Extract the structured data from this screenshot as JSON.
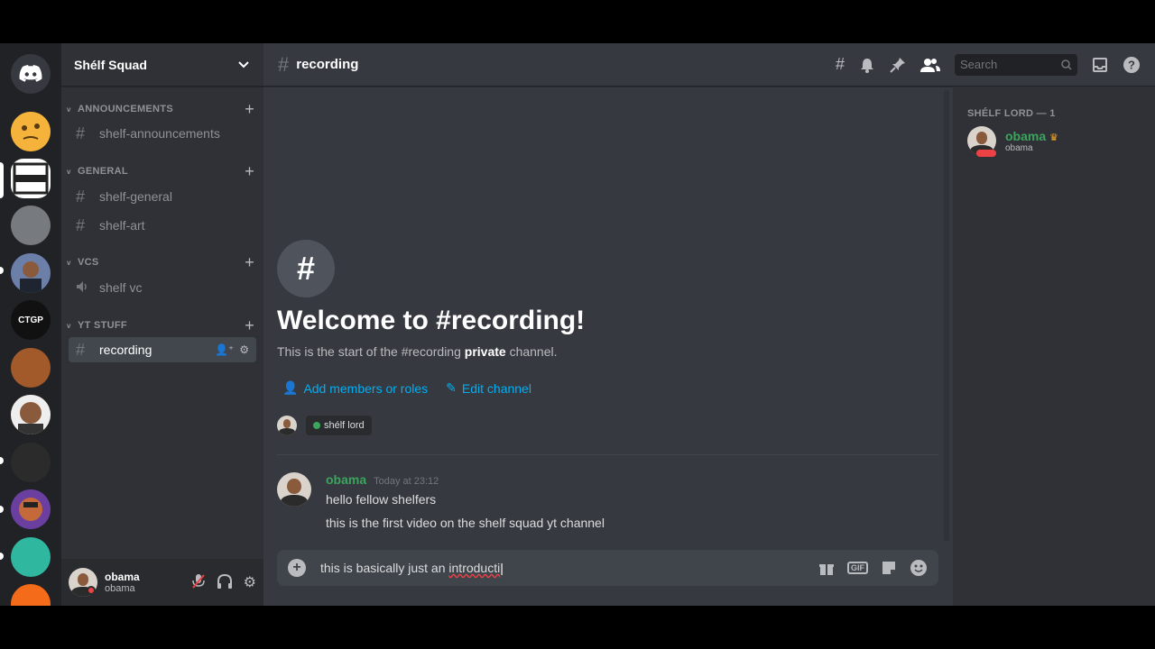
{
  "servers": [
    {
      "name": "home",
      "icon": "discord-icon",
      "color": "#36393f"
    },
    {
      "name": "server-emoji",
      "color": "#f5b33b"
    },
    {
      "name": "server-frame",
      "color": "#ffffff"
    },
    {
      "name": "server-gray",
      "color": "#777b80"
    },
    {
      "name": "server-obama",
      "color": "#3a4f7a"
    },
    {
      "name": "server-records",
      "color": "#111111"
    },
    {
      "name": "server-food",
      "color": "#a35a2a"
    },
    {
      "name": "server-rock",
      "color": "#b7775a"
    },
    {
      "name": "server-dark",
      "color": "#2b2b2b"
    },
    {
      "name": "server-purple",
      "color": "#6b3fa0"
    },
    {
      "name": "server-green",
      "color": "#2fb7a0"
    },
    {
      "name": "server-orange",
      "color": "#f46b1a"
    }
  ],
  "sidebar": {
    "guild_name": "Shélf Squad",
    "categories": [
      {
        "label": "ANNOUNCEMENTS",
        "channels": [
          "shelf-announcements"
        ]
      },
      {
        "label": "GENERAL",
        "channels": [
          "shelf-general",
          "shelf-art"
        ]
      },
      {
        "label": "VCS",
        "channels": [
          "shelf vc"
        ]
      },
      {
        "label": "YT STUFF",
        "channels": [
          "recording"
        ]
      }
    ]
  },
  "user_panel": {
    "name": "obama",
    "tag": "obama"
  },
  "topbar": {
    "channel": "recording",
    "search_placeholder": "Search"
  },
  "welcome": {
    "title": "Welcome to #recording!",
    "sub_pre": "This is the start of the #recording ",
    "sub_bold": "private",
    "sub_post": " channel.",
    "add_members": "Add members or roles",
    "edit_channel": "Edit channel",
    "role": "shélf lord"
  },
  "message": {
    "author": "obama",
    "timestamp": "Today at 23:12",
    "lines": [
      "hello fellow shelfers",
      "this is the first video on the shelf squad yt channel"
    ]
  },
  "composer": {
    "text_main": "this is basically just an ",
    "text_misspelled": "introducti"
  },
  "members": {
    "heading": "SHÉLF LORD — 1",
    "name": "obama",
    "sub": "obama"
  },
  "colors": {
    "accent_link": "#00aff4",
    "online_green": "#3ba55d",
    "dnd_red": "#ed4245",
    "crown": "#faa81a"
  }
}
